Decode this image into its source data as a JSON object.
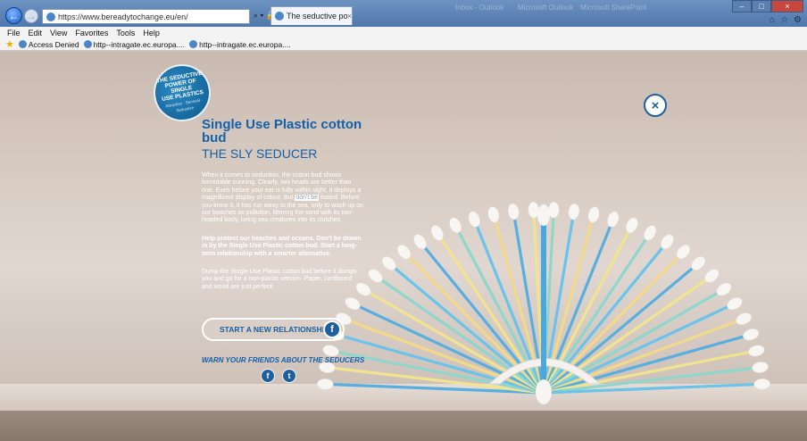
{
  "browser": {
    "url": "https://www.bereadytochange.eu/en/",
    "tab_title": "The seductive power of sin...",
    "tab_close": "×",
    "address_tools": "⌕ ▾ 🔒 C",
    "faint_tabs": [
      "Inbox - Outlook",
      "Microsoft Outlook",
      "Microsoft SharePoint"
    ],
    "window_buttons": [
      "–",
      "□",
      "×"
    ],
    "right_icons": [
      "⌂",
      "☆",
      "⚙"
    ],
    "menu": [
      "File",
      "Edit",
      "View",
      "Favorites",
      "Tools",
      "Help"
    ],
    "favorites": [
      "Access Denied",
      "http--intragate.ec.europa....",
      "http--intragate.ec.europa...."
    ]
  },
  "badge": {
    "lines": [
      "THE SEDUCTIVE",
      "POWER OF",
      "SINGLE",
      "USE PLASTICS"
    ],
    "sub": "Attractive · Sensual · Seductive"
  },
  "article": {
    "title": "Single Use Plastic cotton bud",
    "subtitle": "THE SLY SEDUCER",
    "para_before": "When it comes to seduction, the cotton bud shows formidable cunning. Clearly, two heads are better than one. Even before your ear is fully within sight, it deploys a magnificent display of colour. But",
    "para_highlight": "don't be",
    "para_after": " fooled. Before you know it, it has run away to the sea, only to wash up on our beaches as pollution, littering the sand with its two-headed body, luring sea creatures into its clutches.",
    "cta": "Help protect our beaches and oceans. Don't be drawn in by the Single Use Plastic cotton bud. Start a long-term relationship with a smarter alternative.",
    "dump": "Dump the Single Use Plastic cotton bud before it dumps you and go for a non-plastic version. Paper, cardboard and wood are just perfect!",
    "button": "START A NEW RELATIONSHIP",
    "warn": "WARN YOUR FRIENDS ABOUT THE SEDUCERS"
  },
  "icons": {
    "facebook": "f",
    "twitter": "t",
    "close": "×"
  },
  "colors": {
    "accent": "#1560a8",
    "bud_colors": [
      "#59aee0",
      "#f2e391",
      "#8fd6cc",
      "#6ac3ea",
      "#f3d98a"
    ]
  }
}
